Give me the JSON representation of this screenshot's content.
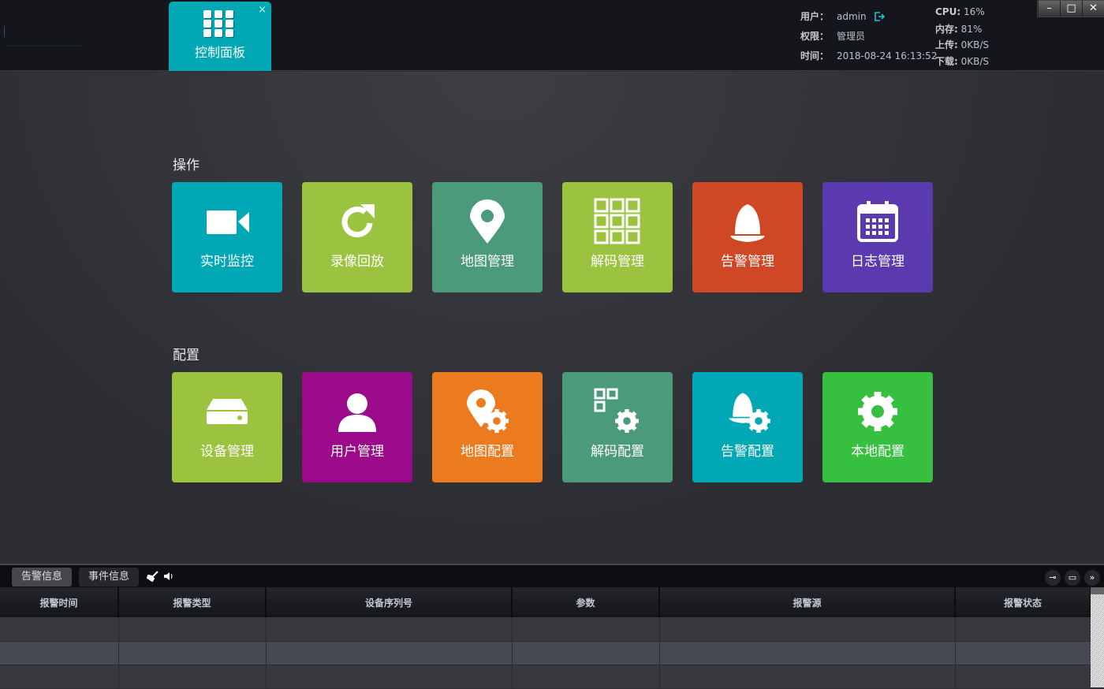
{
  "header": {
    "tab_label": "控制面板",
    "tab_close": "×",
    "user_label": "用户：",
    "user": "admin",
    "perm_label": "权限：",
    "perm": "管理员",
    "time_label": "时间：",
    "time": "2018-08-24 16:13:52",
    "cpu_label": "CPU:",
    "cpu": "16%",
    "mem_label": "内存:",
    "mem": "81%",
    "up_label": "上传:",
    "up": "0KB/S",
    "down_label": "下载:",
    "down": "0KB/S",
    "win": {
      "min": "–",
      "max": "□",
      "close": "✕"
    }
  },
  "sections": {
    "ops": "操作",
    "config": "配置"
  },
  "tiles_ops": [
    {
      "label": "实时监控",
      "icon": "video-camera-icon",
      "color": "#00a8b5"
    },
    {
      "label": "录像回放",
      "icon": "replay-icon",
      "color": "#9bc33f"
    },
    {
      "label": "地图管理",
      "icon": "map-pin-icon",
      "color": "#4b9a7a"
    },
    {
      "label": "解码管理",
      "icon": "grid-icon",
      "color": "#9bc33f"
    },
    {
      "label": "告警管理",
      "icon": "alarm-bell-icon",
      "color": "#d04726"
    },
    {
      "label": "日志管理",
      "icon": "calendar-icon",
      "color": "#5b3ab0"
    }
  ],
  "tiles_config": [
    {
      "label": "设备管理",
      "icon": "device-icon",
      "color": "#9bc33f"
    },
    {
      "label": "用户管理",
      "icon": "user-icon",
      "color": "#9c0a8c"
    },
    {
      "label": "地图配置",
      "icon": "map-gear-icon",
      "color": "#ec7a1f"
    },
    {
      "label": "解码配置",
      "icon": "grid-gear-icon",
      "color": "#4b9a7a"
    },
    {
      "label": "告警配置",
      "icon": "alarm-gear-icon",
      "color": "#00a8b5"
    },
    {
      "label": "本地配置",
      "icon": "gear-icon",
      "color": "#37c040"
    }
  ],
  "bottom": {
    "tabs": [
      "告警信息",
      "事件信息"
    ],
    "columns": [
      "报警时间",
      "报警类型",
      "设备序列号",
      "参数",
      "报警源",
      "报警状态"
    ]
  }
}
